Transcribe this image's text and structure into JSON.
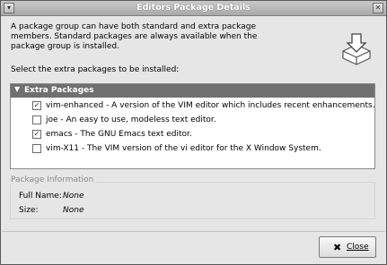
{
  "window": {
    "title": "Editors Package Details",
    "menu_icon": "window-menu-icon",
    "close_icon": "window-close-icon"
  },
  "description": {
    "line1": "A package group can have both standard and extra package",
    "line2": "members.  Standard packages are always available when the",
    "line3": "package group is installed."
  },
  "package_icon": "package-install-icon",
  "select_label": "Select the extra packages to be installed:",
  "extra_packages": {
    "header": "Extra Packages",
    "expanded": true,
    "items": [
      {
        "text": "vim-enhanced - A version of the VIM editor which includes recent enhancements.",
        "checked": true
      },
      {
        "text": "joe - An easy to use, modeless text editor.",
        "checked": false
      },
      {
        "text": "emacs - The GNU Emacs text editor.",
        "checked": true
      },
      {
        "text": "vim-X11 - The VIM version of the vi editor for the X Window System.",
        "checked": false
      }
    ]
  },
  "package_info": {
    "legend": "Package Information",
    "full_name_label": "Full Name:",
    "full_name_value": "None",
    "size_label": "Size:",
    "size_value": "None"
  },
  "buttons": {
    "close_label": "Close",
    "close_icon": "close-x-icon"
  }
}
